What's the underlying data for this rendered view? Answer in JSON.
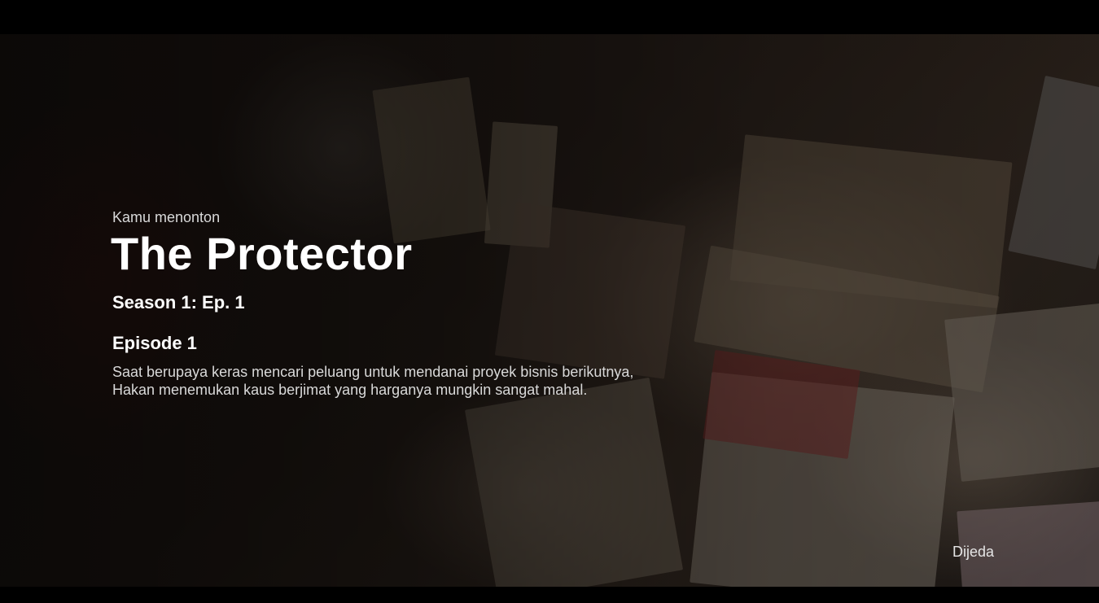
{
  "player": {
    "watching_label": "Kamu menonton",
    "show_title": "The Protector",
    "season_episode": "Season 1: Ep. 1",
    "episode_title": "Episode 1",
    "synopsis": "Saat berupaya keras mencari peluang untuk mendanai proyek bisnis berikutnya, Hakan menemukan kaus berjimat yang harganya mungkin sangat mahal.",
    "status": "Dijeda"
  },
  "colors": {
    "background": "#000000",
    "text_primary": "#ffffff",
    "text_secondary": "#d9d9d9"
  }
}
